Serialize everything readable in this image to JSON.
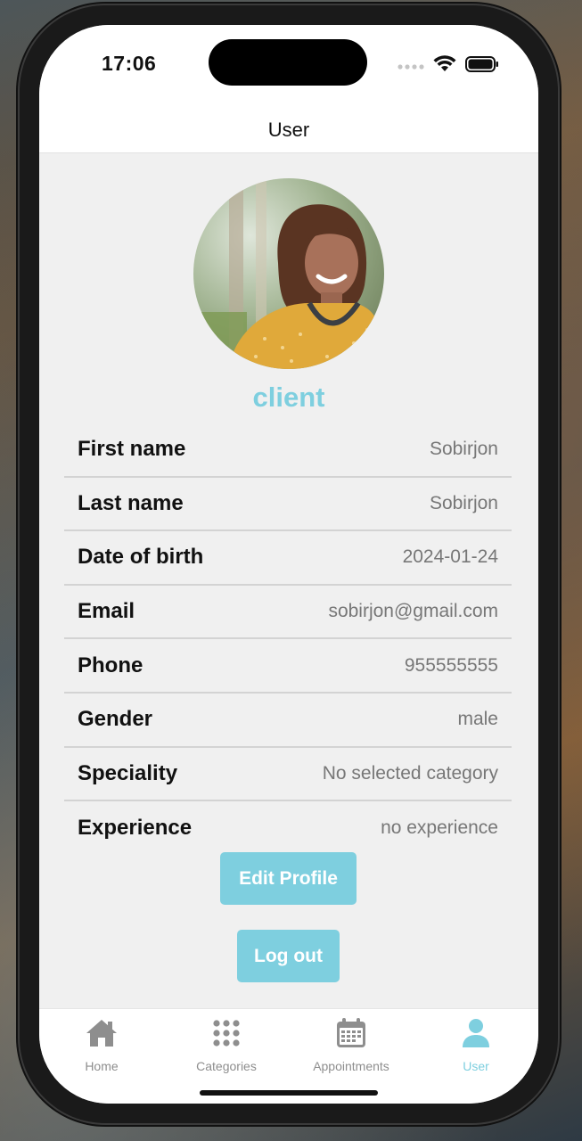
{
  "status_bar": {
    "time": "17:06"
  },
  "header": {
    "title": "User"
  },
  "profile": {
    "role": "client",
    "fields": [
      {
        "label": "First name",
        "value": "Sobirjon"
      },
      {
        "label": "Last name",
        "value": "Sobirjon"
      },
      {
        "label": "Date of birth",
        "value": "2024-01-24"
      },
      {
        "label": "Email",
        "value": "sobirjon@gmail.com"
      },
      {
        "label": "Phone",
        "value": "955555555"
      },
      {
        "label": "Gender",
        "value": "male"
      },
      {
        "label": "Speciality",
        "value": "No selected category"
      },
      {
        "label": "Experience",
        "value": "no experience"
      }
    ]
  },
  "actions": {
    "edit_label": "Edit Profile",
    "logout_label": "Log out"
  },
  "tabbar": {
    "items": [
      {
        "label": "Home",
        "icon": "home-icon"
      },
      {
        "label": "Categories",
        "icon": "grid-icon"
      },
      {
        "label": "Appointments",
        "icon": "calendar-icon"
      },
      {
        "label": "User",
        "icon": "user-icon"
      }
    ],
    "active": "User"
  },
  "colors": {
    "accent": "#7ecfdf",
    "inactive": "#8e8e8e",
    "background": "#f0f0f0"
  }
}
